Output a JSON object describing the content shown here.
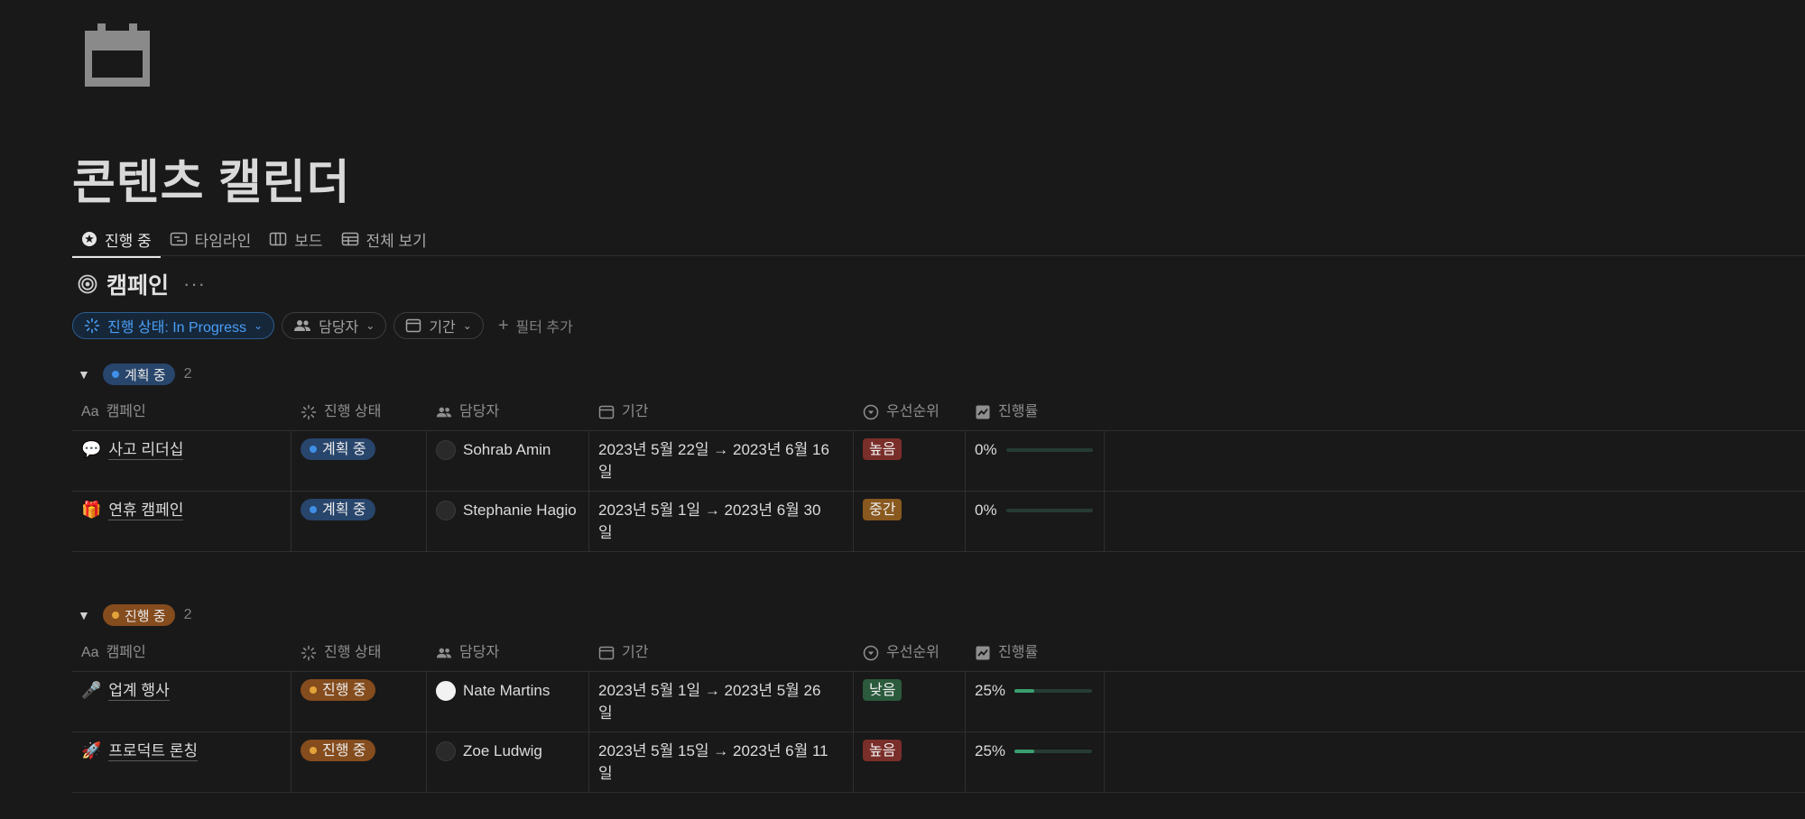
{
  "page": {
    "title": "콘텐츠 캘린더",
    "icon": "calendar-icon"
  },
  "tabs": [
    {
      "label": "진행 중",
      "icon": "star-circle-icon",
      "active": true
    },
    {
      "label": "타임라인",
      "icon": "timeline-icon",
      "active": false
    },
    {
      "label": "보드",
      "icon": "board-icon",
      "active": false
    },
    {
      "label": "전체 보기",
      "icon": "table-icon",
      "active": false
    }
  ],
  "view": {
    "name": "캠페인",
    "icon": "target-icon",
    "more": "···"
  },
  "filters": {
    "status": "진행 상태: In Progress",
    "assignee": "담당자",
    "period": "기간",
    "add": "필터 추가"
  },
  "columns": {
    "campaign": "캠페인",
    "campaign_prefix": "Aa",
    "status": "진행 상태",
    "assignee": "담당자",
    "period": "기간",
    "priority": "우선순위",
    "progress": "진행률"
  },
  "groups": [
    {
      "label": "계획 중",
      "count": "2",
      "color": "#3f8fe6",
      "rows": [
        {
          "emoji": "💬",
          "name": "사고 리더십",
          "status": "계획 중",
          "assignee": "Sohrab Amin",
          "period_line1": "2023년 5월 22일 → 2023년 6월 16",
          "period_line2": "일",
          "priority": "높음",
          "priority_color": "#7a2e2a",
          "progress_label": "0%",
          "progress_value": 0
        },
        {
          "emoji": "🎁",
          "name": "연휴 캠페인",
          "status": "계획 중",
          "assignee": "Stephanie Hagio",
          "period_line1": "2023년 5월 1일 → 2023년 6월 30",
          "period_line2": "일",
          "priority": "중간",
          "priority_color": "#89591f",
          "progress_label": "0%",
          "progress_value": 0
        }
      ]
    },
    {
      "label": "진행 중",
      "count": "2",
      "color": "#e2a33a",
      "rows": [
        {
          "emoji": "🎤",
          "name": "업계 행사",
          "status": "진행 중",
          "assignee": "Nate Martins",
          "period_line1": "2023년 5월 1일 → 2023년 5월 26",
          "period_line2": "일",
          "priority": "낮음",
          "priority_color": "#2b5a3c",
          "progress_label": "25%",
          "progress_value": 0.25
        },
        {
          "emoji": "🚀",
          "name": "프로덕트 론칭",
          "status": "진행 중",
          "assignee": "Zoe Ludwig",
          "period_line1": "2023년 5월 15일 → 2023년 6월 11",
          "period_line2": "일",
          "priority": "높음",
          "priority_color": "#7a2e2a",
          "progress_label": "25%",
          "progress_value": 0.25
        }
      ]
    }
  ]
}
